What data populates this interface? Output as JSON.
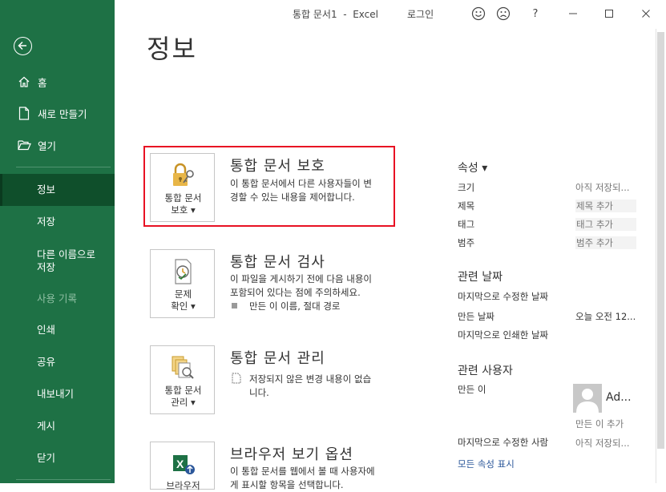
{
  "titlebar": {
    "title": "통합 문서1  -  Excel",
    "signin": "로그인",
    "help": "?"
  },
  "sidebar": {
    "items": [
      {
        "label": "홈"
      },
      {
        "label": "새로 만들기"
      },
      {
        "label": "열기"
      },
      {
        "label": "정보"
      },
      {
        "label": "저장"
      },
      {
        "label": "다른 이름으로\n저장"
      },
      {
        "label": "사용 기록"
      },
      {
        "label": "인쇄"
      },
      {
        "label": "공유"
      },
      {
        "label": "내보내기"
      },
      {
        "label": "게시"
      },
      {
        "label": "닫기"
      }
    ]
  },
  "main": {
    "title": "정보",
    "sections": [
      {
        "card_label": "통합 문서\n보호 ▾",
        "title": "통합 문서 보호",
        "desc": "이 통합 문서에서 다른 사용자들이 변\n경할 수 있는 내용을 제어합니다."
      },
      {
        "card_label": "문제\n확인 ▾",
        "title": "통합 문서 검사",
        "desc": "이 파일을 게시하기 전에 다음 내용이\n포함되어 있다는 점에 주의하세요.",
        "bullet": "만든 이 이름, 절대 경로"
      },
      {
        "card_label": "통합 문서\n관리 ▾",
        "title": "통합 문서 관리",
        "desc": "저장되지 않은 변경 내용이 없습\n니다."
      },
      {
        "card_label": "브라우저",
        "title": "브라우저 보기 옵션",
        "desc": "이 통합 문서를 웹에서 볼 때 사용자에\n게 표시할 항목을 선택합니다."
      }
    ]
  },
  "properties": {
    "heading": "속성 ▾",
    "rows": [
      {
        "label": "크기",
        "value": "아직 저장되..."
      },
      {
        "label": "제목",
        "value": "제목 추가"
      },
      {
        "label": "태그",
        "value": "태그 추가"
      },
      {
        "label": "범주",
        "value": "범주 추가"
      }
    ],
    "dates_heading": "관련 날짜",
    "dates": [
      {
        "label": "마지막으로 수정한 날짜",
        "value": ""
      },
      {
        "label": "만든 날짜",
        "value": "오늘 오전 12..."
      },
      {
        "label": "마지막으로 인쇄한 날짜",
        "value": ""
      }
    ],
    "people_heading": "관련 사용자",
    "author_label": "만든 이",
    "author_name": "Ad...",
    "add_author": "만든 이 추가",
    "last_modified_by_label": "마지막으로 수정한 사람",
    "last_modified_by_value": "아직 저장되...",
    "show_all": "모든 속성 표시"
  }
}
